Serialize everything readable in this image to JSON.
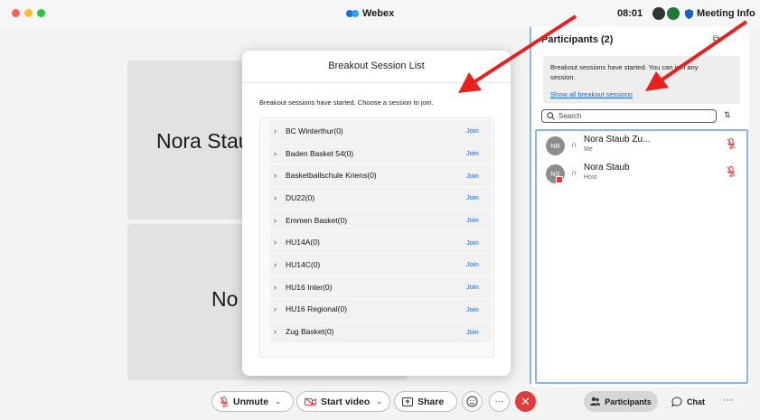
{
  "window": {
    "app_title": "Webex",
    "time": "08:01",
    "meeting_info": "Meeting Info"
  },
  "tiles": [
    {
      "name": "Nora Stau"
    },
    {
      "name": "No"
    }
  ],
  "dialog": {
    "title": "Breakout Session List",
    "close_glyph": "×",
    "description": "Breakout sessions have started. Choose a session to join.",
    "join_label": "Join",
    "sessions": [
      {
        "name": "BC Winterthur(0)"
      },
      {
        "name": "Baden Basket 54(0)"
      },
      {
        "name": "Basketballschule Kriens(0)"
      },
      {
        "name": "DU22(0)"
      },
      {
        "name": "Emmen Basket(0)"
      },
      {
        "name": "HU14A(0)"
      },
      {
        "name": "HU14C(0)"
      },
      {
        "name": "HU16 Inter(0)"
      },
      {
        "name": "HU16 Regional(0)"
      },
      {
        "name": "Zug Basket(0)"
      }
    ]
  },
  "panel": {
    "title": "Participants (2)",
    "notice_text": "Breakout sessions have started. You can join any session.",
    "notice_link": "Show all breakout sessions",
    "search_placeholder": "Search",
    "participants": [
      {
        "initials": "NB",
        "name": "Nora Staub Zu...",
        "role": "Me"
      },
      {
        "initials": "NS",
        "name": "Nora Staub",
        "role": "Host"
      }
    ]
  },
  "toolbar": {
    "unmute": "Unmute",
    "start_video": "Start video",
    "share": "Share",
    "participants": "Participants",
    "chat": "Chat",
    "more": "···"
  },
  "colors": {
    "accent": "#1a64c8",
    "end_call": "#e33b3b",
    "annotation_arrow": "#e8201e"
  }
}
